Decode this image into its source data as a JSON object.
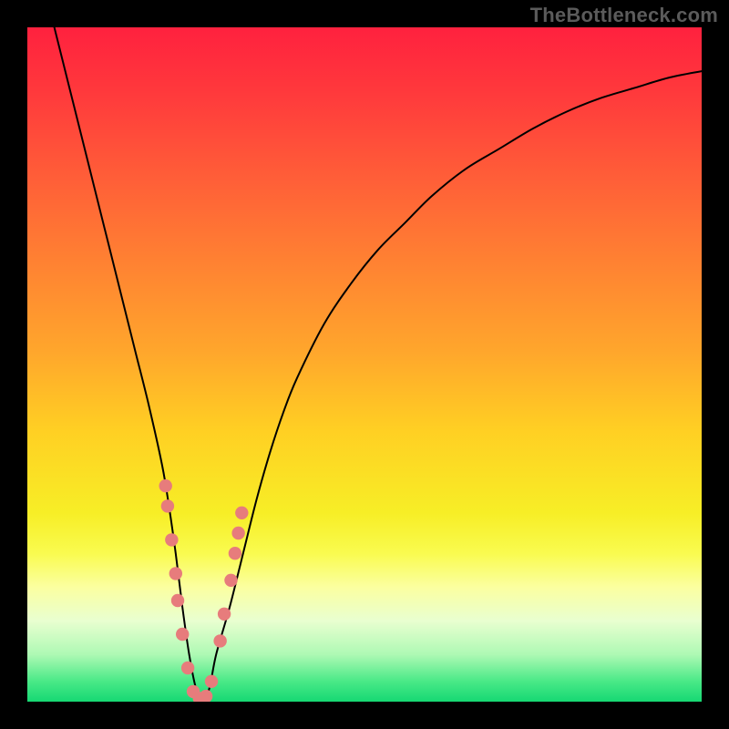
{
  "watermark": "TheBottleneck.com",
  "colors": {
    "frame": "#000000",
    "curve_stroke": "#000000",
    "marker_fill": "#e77c7c",
    "marker_stroke": "#d96f6f",
    "gradient_stops": [
      {
        "offset": 0.0,
        "color": "#ff213e"
      },
      {
        "offset": 0.1,
        "color": "#ff3a3c"
      },
      {
        "offset": 0.22,
        "color": "#ff5d38"
      },
      {
        "offset": 0.35,
        "color": "#ff8232"
      },
      {
        "offset": 0.48,
        "color": "#ffa62c"
      },
      {
        "offset": 0.6,
        "color": "#ffd023"
      },
      {
        "offset": 0.72,
        "color": "#f7ee26"
      },
      {
        "offset": 0.78,
        "color": "#f9fb4f"
      },
      {
        "offset": 0.83,
        "color": "#fbffa0"
      },
      {
        "offset": 0.88,
        "color": "#e9ffd0"
      },
      {
        "offset": 0.93,
        "color": "#aef9b4"
      },
      {
        "offset": 0.97,
        "color": "#49e987"
      },
      {
        "offset": 1.0,
        "color": "#16d873"
      }
    ]
  },
  "chart_data": {
    "type": "line",
    "title": "",
    "xlabel": "",
    "ylabel": "",
    "xlim": [
      0,
      100
    ],
    "ylim": [
      0,
      100
    ],
    "x": [
      4,
      6,
      8,
      10,
      12,
      14,
      16,
      18,
      20,
      21,
      22,
      23,
      24,
      25,
      26,
      27,
      28,
      30,
      32,
      34,
      36,
      38,
      40,
      44,
      48,
      52,
      56,
      60,
      65,
      70,
      75,
      80,
      85,
      90,
      95,
      100
    ],
    "y": [
      100,
      92,
      84,
      76,
      68,
      60,
      52,
      44,
      35,
      29,
      22,
      14,
      7,
      2,
      0,
      2,
      7,
      14,
      22,
      30,
      37,
      43,
      48,
      56,
      62,
      67,
      71,
      75,
      79,
      82,
      85,
      87.5,
      89.5,
      91,
      92.5,
      93.5
    ],
    "markers": [
      {
        "x": 20.5,
        "y": 32
      },
      {
        "x": 20.8,
        "y": 29
      },
      {
        "x": 21.4,
        "y": 24
      },
      {
        "x": 22.0,
        "y": 19
      },
      {
        "x": 22.3,
        "y": 15
      },
      {
        "x": 23.0,
        "y": 10
      },
      {
        "x": 23.8,
        "y": 5
      },
      {
        "x": 24.6,
        "y": 1.5
      },
      {
        "x": 25.5,
        "y": 0.5
      },
      {
        "x": 26.5,
        "y": 0.8
      },
      {
        "x": 27.3,
        "y": 3
      },
      {
        "x": 28.6,
        "y": 9
      },
      {
        "x": 29.2,
        "y": 13
      },
      {
        "x": 30.2,
        "y": 18
      },
      {
        "x": 30.8,
        "y": 22
      },
      {
        "x": 31.3,
        "y": 25
      },
      {
        "x": 31.8,
        "y": 28
      }
    ],
    "minimum_x": 25.5
  }
}
